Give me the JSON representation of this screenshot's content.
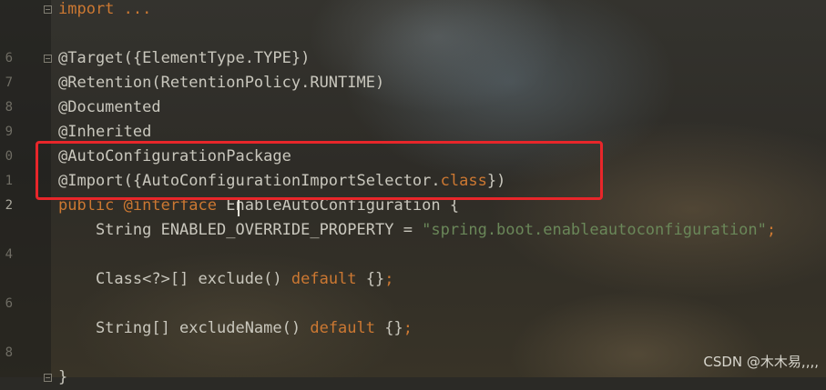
{
  "editor": {
    "line_numbers": [
      "",
      "",
      "6",
      "7",
      "8",
      "9",
      "0",
      "1",
      "2",
      "",
      "4",
      "",
      "6",
      "",
      "8",
      ""
    ],
    "lines": [
      [
        {
          "t": "import ...",
          "c": "import"
        }
      ],
      [],
      [
        {
          "t": "@Target({ElementType.TYPE})",
          "c": "anno"
        }
      ],
      [
        {
          "t": "@Retention(RetentionPolicy.RUNTIME)",
          "c": "anno"
        }
      ],
      [
        {
          "t": "@Documented",
          "c": "anno"
        }
      ],
      [
        {
          "t": "@Inherited",
          "c": "anno"
        }
      ],
      [
        {
          "t": "@AutoConfigurationPackage",
          "c": "anno"
        }
      ],
      [
        {
          "t": "@Import({AutoConfigurationImportSelector.",
          "c": "anno"
        },
        {
          "t": "class",
          "c": "kw"
        },
        {
          "t": "})",
          "c": "anno"
        }
      ],
      [
        {
          "t": "public ",
          "c": "kw"
        },
        {
          "t": "@interface ",
          "c": "kw"
        },
        {
          "t": "EnableAutoConfiguration {",
          "c": "ident"
        }
      ],
      [
        {
          "t": "    String ENABLED_OVERRIDE_PROPERTY = ",
          "c": "ident"
        },
        {
          "t": "\"spring.boot.enableautoconfiguration\"",
          "c": "str"
        },
        {
          "t": ";",
          "c": "kw"
        }
      ],
      [],
      [
        {
          "t": "    Class<?>[] exclude() ",
          "c": "ident"
        },
        {
          "t": "default ",
          "c": "kw"
        },
        {
          "t": "{}",
          "c": "ident"
        },
        {
          "t": ";",
          "c": "kw"
        }
      ],
      [],
      [
        {
          "t": "    String[] excludeName() ",
          "c": "ident"
        },
        {
          "t": "default ",
          "c": "kw"
        },
        {
          "t": "{}",
          "c": "ident"
        },
        {
          "t": ";",
          "c": "kw"
        }
      ],
      [],
      [
        {
          "t": "}",
          "c": "ident"
        }
      ]
    ]
  },
  "colors": {
    "highlight_box": "#e8262a",
    "keyword": "#cc7832",
    "string": "#6a8759"
  },
  "watermark": "CSDN @木木易,,,,"
}
